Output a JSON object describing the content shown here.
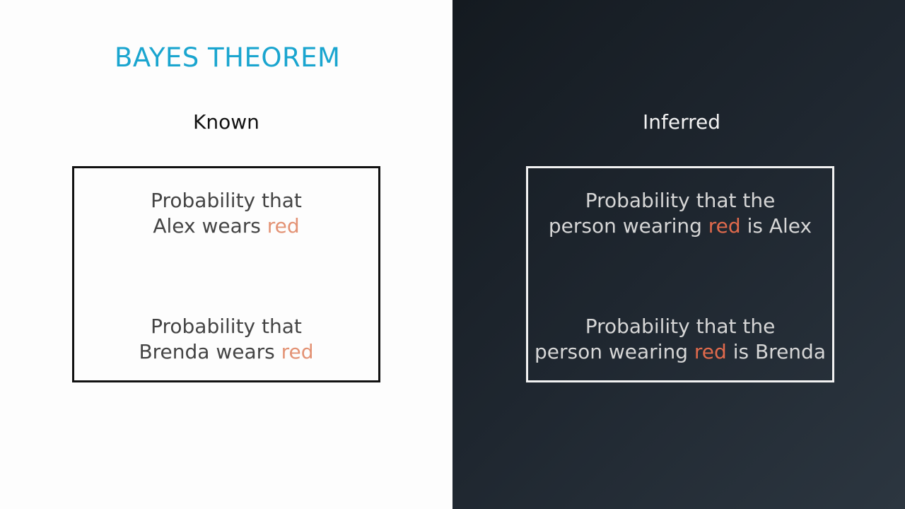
{
  "title": "BAYES THEOREM",
  "known": {
    "heading": "Known",
    "statements": [
      {
        "line1": "Probability that",
        "line2_pre": "Alex wears ",
        "highlight": "red",
        "line2_post": ""
      },
      {
        "line1": "Probability that",
        "line2_pre": "Brenda wears ",
        "highlight": "red",
        "line2_post": ""
      }
    ]
  },
  "inferred": {
    "heading": "Inferred",
    "statements": [
      {
        "line1": "Probability that the",
        "line2_pre": "person wearing ",
        "highlight": "red",
        "line2_post": " is Alex"
      },
      {
        "line1": "Probability that the",
        "line2_pre": "person wearing ",
        "highlight": "red",
        "line2_post": " is Brenda"
      }
    ]
  },
  "colors": {
    "title": "#1aa5cf",
    "highlight_light": "#e39274",
    "highlight_dark": "#e06a4c",
    "left_background": "#fdfdfd",
    "right_background": "#1f2730"
  }
}
